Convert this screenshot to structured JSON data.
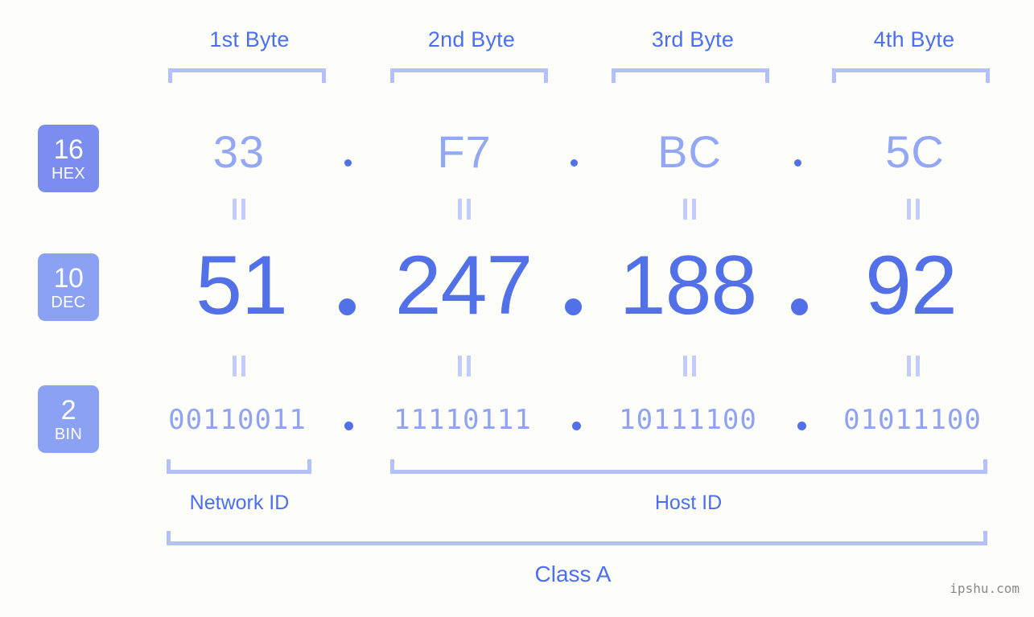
{
  "background": "#fdfdfa",
  "colors": {
    "accent": "#4c6ef0",
    "decimal": "#5271e8",
    "hex": "#93a8f4",
    "binary": "#8fa3f2",
    "bracket": "#b4c0fb",
    "badge": "#7b8ef0",
    "badge_light": "#8ba2f4",
    "watermark": "#8a8a8a"
  },
  "header": {
    "bytes": [
      {
        "label": "1st Byte"
      },
      {
        "label": "2nd Byte"
      },
      {
        "label": "3rd Byte"
      },
      {
        "label": "4th Byte"
      }
    ]
  },
  "rows": {
    "hex": {
      "badge_num": "16",
      "badge_abbr": "HEX",
      "values": [
        "33",
        "F7",
        "BC",
        "5C"
      ],
      "separator": "."
    },
    "dec": {
      "badge_num": "10",
      "badge_abbr": "DEC",
      "values": [
        "51",
        "247",
        "188",
        "92"
      ],
      "separator": "."
    },
    "bin": {
      "badge_num": "2",
      "badge_abbr": "BIN",
      "values": [
        "00110011",
        "11110111",
        "10111100",
        "01011100"
      ],
      "separator": "."
    }
  },
  "equals_symbol": "=",
  "footer": {
    "network_id_label": "Network ID",
    "host_id_label": "Host ID",
    "class_label": "Class A"
  },
  "watermark": "ipshu.com"
}
